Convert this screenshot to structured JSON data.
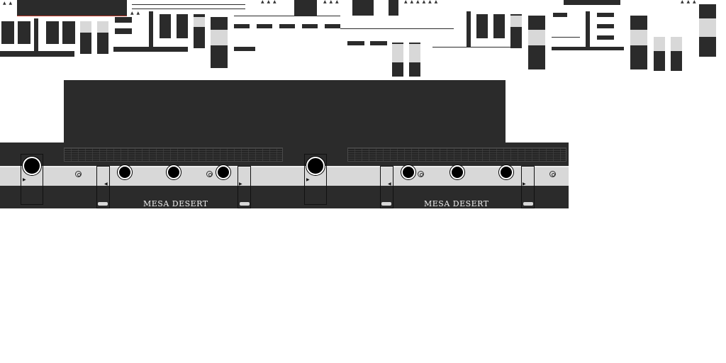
{
  "panel": {
    "brand_left": "MESA DESERT",
    "brand_right": "MESA DESERT"
  },
  "colors": {
    "chassis": "#2b2b2b",
    "stripe": "#d8d8d8",
    "knob": "#000000",
    "accent_line": "#c0392b"
  },
  "icons": [
    "arrow-up-glyph",
    "knob-icon",
    "jack-icon",
    "play-arrow-icon",
    "vent-grille",
    "foot-icon"
  ]
}
